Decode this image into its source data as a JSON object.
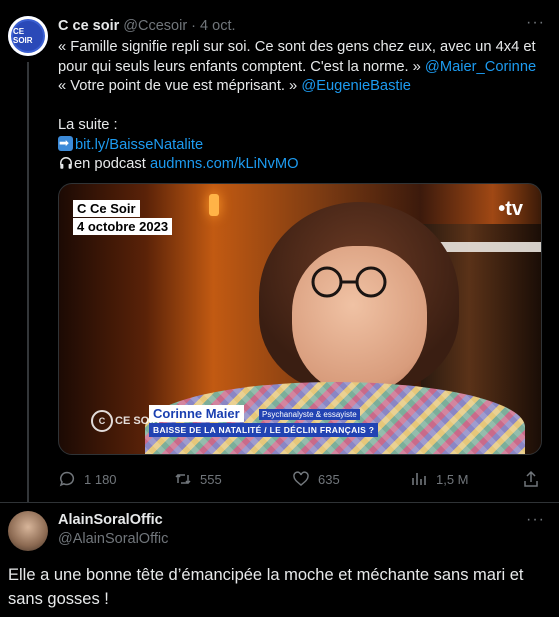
{
  "tweet": {
    "author_name": "C ce soir",
    "author_handle": "@Ccesoir",
    "separator": " · ",
    "date": "4 oct.",
    "avatar_text": "CE SOIR",
    "more": "···",
    "lines": {
      "l1": "« Famille signifie repli sur soi. Ce sont des gens chez eux, avec un 4x4 et",
      "l2a": "pour qui seuls leurs enfants comptent. C'est la norme. » ",
      "l2b": "@Maier_Corinne",
      "l3a": "« Votre point de vue est méprisant. » ",
      "l3b": "@EugenieBastie",
      "l4": "La suite :",
      "l5": "bit.ly/BaisseNatalite",
      "l6a": "en podcast ",
      "l6b": "audmns.com/kLiNvMO"
    },
    "media": {
      "show_tag": "C Ce Soir",
      "date_tag": "4 octobre 2023",
      "channel": "•tv",
      "corner_logo": "CE SOIR",
      "guest_name": "Corinne Maier",
      "guest_role": "Psychanalyste & essayiste",
      "topic": "BAISSE DE LA NATALITÉ / LE DÉCLIN FRANÇAIS ?"
    },
    "stats": {
      "replies": "1 180",
      "retweets": "555",
      "likes": "635",
      "views": "1,5 M"
    }
  },
  "reply": {
    "author_name": "AlainSoralOffic",
    "author_handle": "@AlainSoralOffic",
    "more": "···",
    "text": "Elle a une bonne tête d’émancipée la moche et méchante sans mari et sans gosses !"
  },
  "colors": {
    "background": "#000000",
    "text": "#e7e9ea",
    "muted": "#71767b",
    "link": "#1d9bf0"
  }
}
